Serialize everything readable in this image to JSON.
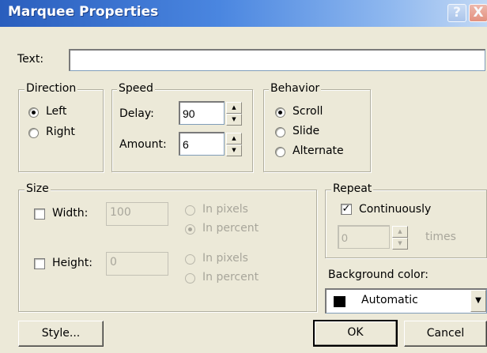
{
  "window": {
    "title": "Marquee Properties",
    "help_icon": "?",
    "close_icon": "X"
  },
  "text_field": {
    "label": "Text:",
    "value": ""
  },
  "direction": {
    "legend": "Direction",
    "options": [
      {
        "label": "Left",
        "checked": true
      },
      {
        "label": "Right",
        "checked": false
      }
    ]
  },
  "speed": {
    "legend": "Speed",
    "delay_label": "Delay:",
    "delay_value": "90",
    "amount_label": "Amount:",
    "amount_value": "6"
  },
  "behavior": {
    "legend": "Behavior",
    "options": [
      {
        "label": "Scroll",
        "checked": true
      },
      {
        "label": "Slide",
        "checked": false
      },
      {
        "label": "Alternate",
        "checked": false
      }
    ]
  },
  "size": {
    "legend": "Size",
    "width_label": "Width:",
    "width_value": "100",
    "width_checked": false,
    "width_units": [
      {
        "label": "In pixels",
        "checked": false
      },
      {
        "label": "In percent",
        "checked": true
      }
    ],
    "height_label": "Height:",
    "height_value": "0",
    "height_checked": false,
    "height_units": [
      {
        "label": "In pixels",
        "checked": false
      },
      {
        "label": "In percent",
        "checked": false
      }
    ]
  },
  "repeat": {
    "legend": "Repeat",
    "continuously_label": "Continuously",
    "continuously_checked": true,
    "times_value": "0",
    "times_label": "times"
  },
  "background": {
    "label": "Background color:",
    "value": "Automatic",
    "swatch_color": "#000000"
  },
  "buttons": {
    "style": "Style...",
    "ok": "OK",
    "cancel": "Cancel"
  },
  "colors": {
    "title_bar": "#2a5ebd",
    "dialog_bg": "#ece9d8",
    "disabled_text": "#a8a69b"
  }
}
